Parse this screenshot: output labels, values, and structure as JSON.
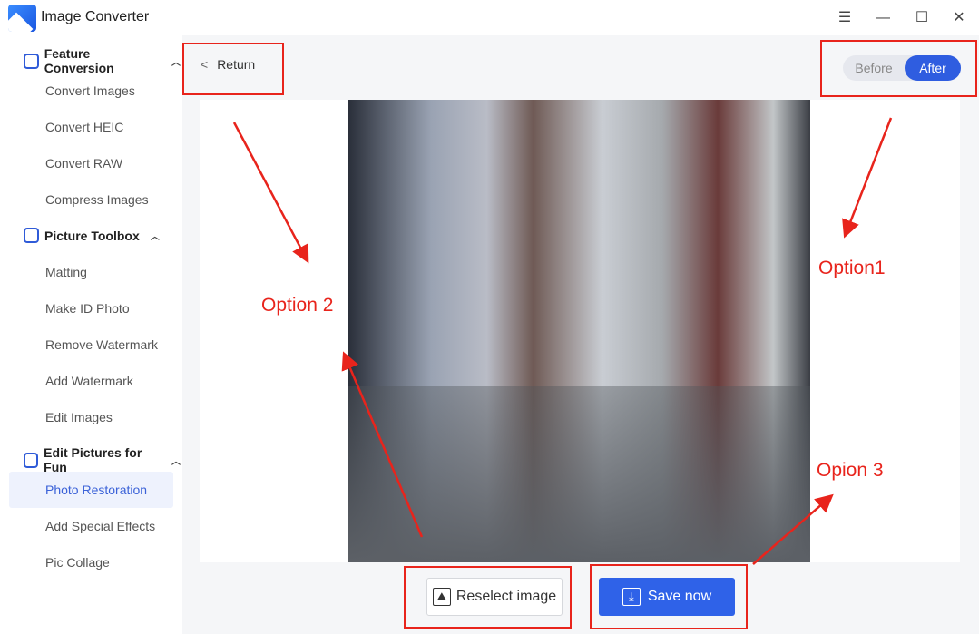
{
  "app": {
    "title": "Image Converter"
  },
  "window": {
    "menu_icon": "☰",
    "minimize_icon": "—",
    "maximize_icon": "☐",
    "close_icon": "✕"
  },
  "sidebar": {
    "groups": [
      {
        "label": "Feature Conversion",
        "items": [
          "Convert Images",
          "Convert HEIC",
          "Convert RAW",
          "Compress Images"
        ]
      },
      {
        "label": "Picture Toolbox",
        "items": [
          "Matting",
          "Make ID Photo",
          "Remove Watermark",
          "Add Watermark",
          "Edit Images"
        ]
      },
      {
        "label": "Edit Pictures for Fun",
        "items": [
          "Photo Restoration",
          "Add Special Effects",
          "Pic Collage"
        ]
      }
    ],
    "active": "Photo Restoration"
  },
  "main": {
    "return_label": "Return",
    "toggle": {
      "before": "Before",
      "after": "After",
      "selected": "After"
    },
    "reselect_label": "Reselect image",
    "save_label": "Save now"
  },
  "annotations": {
    "option1": "Option1",
    "option2": "Option 2",
    "option3": "Opion 3",
    "color": "#e8241c"
  }
}
